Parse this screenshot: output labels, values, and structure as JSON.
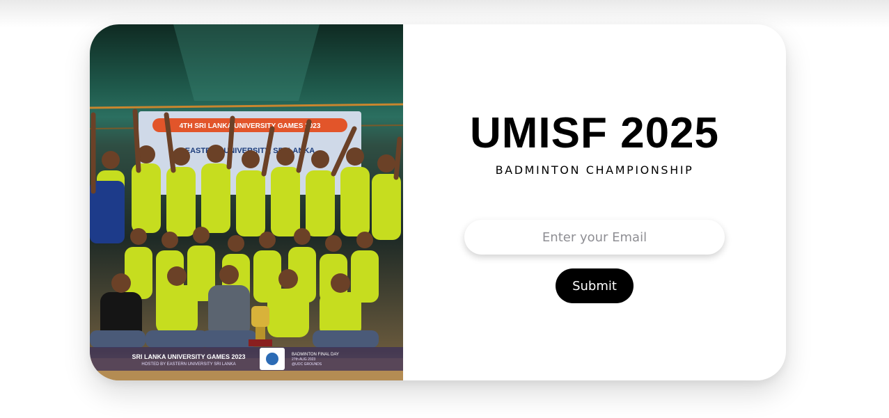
{
  "brand": {
    "title": "UMISF 2025",
    "subtitle": "BADMINTON CHAMPIONSHIP"
  },
  "form": {
    "email_placeholder": "Enter your Email",
    "submit_label": "Submit"
  },
  "photo": {
    "banner_top": "4TH SRI LANKA UNIVERSITY GAMES 2023",
    "banner_host": "EASTERN UNIVERSITY, SRI LANKA",
    "footer_title": "SRI LANKA UNIVERSITY GAMES 2023",
    "footer_sub": "HOSTED BY EASTERN UNIVERSITY SRI LANKA",
    "footer_event": "BADMINTON FINAL DAY",
    "footer_date": "27th AUG 2023",
    "footer_venue": "@UOC GROUNDS"
  },
  "colors": {
    "jersey": "#c6dd1f",
    "accent_black": "#000000",
    "placeholder": "#8e8e93"
  }
}
